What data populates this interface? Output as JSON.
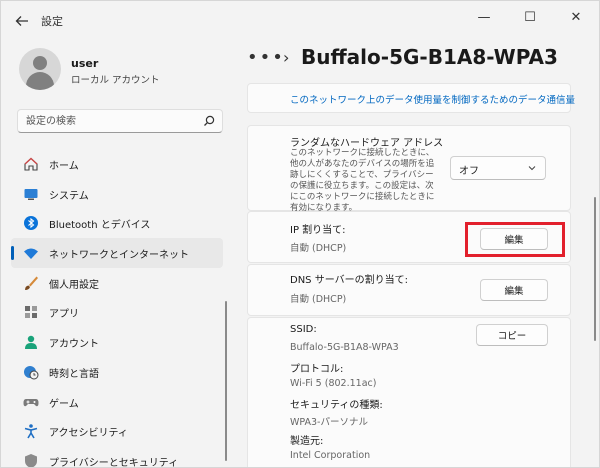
{
  "window": {
    "title": "設定",
    "back_icon": "arrow-left-icon",
    "controls": {
      "minimize": "—",
      "maximize": "☐",
      "close": "✕"
    }
  },
  "profile": {
    "name": "user",
    "account_type": "ローカル アカウント"
  },
  "search": {
    "placeholder": "設定の検索",
    "icon": "search-icon"
  },
  "nav": [
    {
      "label": "ホーム",
      "icon": "home-icon",
      "active": false
    },
    {
      "label": "システム",
      "icon": "monitor-icon",
      "active": false
    },
    {
      "label": "Bluetooth とデバイス",
      "icon": "bluetooth-icon",
      "active": false
    },
    {
      "label": "ネットワークとインターネット",
      "icon": "wifi-icon",
      "active": true
    },
    {
      "label": "個人用設定",
      "icon": "brush-icon",
      "active": false
    },
    {
      "label": "アプリ",
      "icon": "apps-icon",
      "active": false
    },
    {
      "label": "アカウント",
      "icon": "person-icon",
      "active": false
    },
    {
      "label": "時刻と言語",
      "icon": "globe-clock-icon",
      "active": false
    },
    {
      "label": "ゲーム",
      "icon": "gamepad-icon",
      "active": false
    },
    {
      "label": "アクセシビリティ",
      "icon": "accessibility-icon",
      "active": false
    },
    {
      "label": "プライバシーとセキュリティ",
      "icon": "shield-icon",
      "active": false
    }
  ],
  "breadcrumb": {
    "ellipsis": "•••",
    "chevron": "›",
    "title": "Buffalo-5G-B1A8-WPA3"
  },
  "data_usage_link": "このネットワーク上のデータ使用量を制御するためのデータ通信量",
  "random_hw": {
    "title": "ランダムなハードウェア アドレス",
    "desc": "このネットワークに接続したときに、他の人があなたのデバイスの場所を追跡しにくくすることで、プライバシーの保護に役立ちます。この設定は、次にこのネットワークに接続したときに有効になります。",
    "value": "オフ"
  },
  "ip_assign": {
    "title": "IP 割り当て:",
    "value": "自動 (DHCP)",
    "button": "編集"
  },
  "dns_assign": {
    "title": "DNS サーバーの割り当て:",
    "value": "自動 (DHCP)",
    "button": "編集"
  },
  "properties": {
    "copy_button": "コピー",
    "ssid_label": "SSID:",
    "ssid_value": "Buffalo-5G-B1A8-WPA3",
    "protocol_label": "プロトコル:",
    "protocol_value": "Wi-Fi 5 (802.11ac)",
    "security_label": "セキュリティの種類:",
    "security_value": "WPA3-パーソナル",
    "manufacturer_label": "製造元:",
    "manufacturer_value": "Intel Corporation"
  },
  "colors": {
    "accent": "#005fb8",
    "link": "#0067c0",
    "highlight": "#e2202c"
  }
}
